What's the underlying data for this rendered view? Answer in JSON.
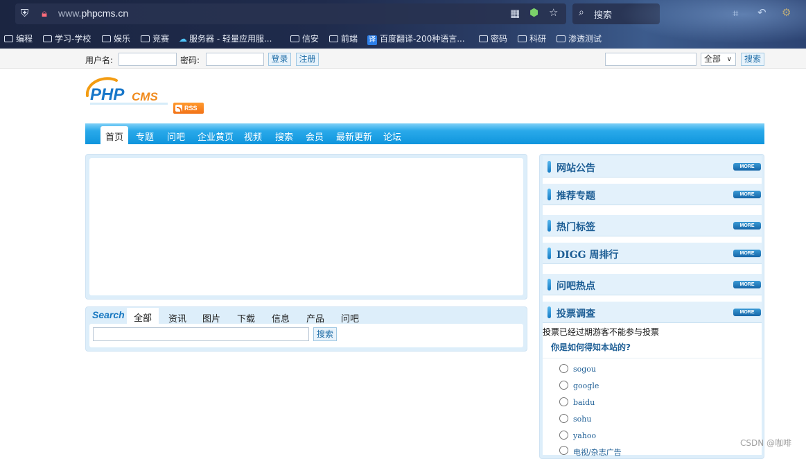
{
  "browser": {
    "url_dim": "www.",
    "url_host": "phpcms.cn",
    "search_placeholder": "搜索",
    "bookmarks": [
      {
        "label": "编程"
      },
      {
        "label": "学习-学校"
      },
      {
        "label": "娱乐"
      },
      {
        "label": "竞赛"
      },
      {
        "label": "服务器 - 轻量应用服..."
      },
      {
        "label": "信安"
      },
      {
        "label": "前端"
      },
      {
        "label": "百度翻译-200种语言..."
      },
      {
        "label": "密码"
      },
      {
        "label": "科研"
      },
      {
        "label": "渗透测试"
      }
    ],
    "translate_badge": "译"
  },
  "topbar": {
    "username_label": "用户名:",
    "password_label": "密码:",
    "login_label": "登录",
    "register_label": "注册",
    "scope_value": "全部",
    "search_label": "搜索"
  },
  "logo": {
    "text_php": "PHP",
    "text_cms": "CMS",
    "rss": "RSS"
  },
  "nav": {
    "items": [
      {
        "label": "首页"
      },
      {
        "label": "专题"
      },
      {
        "label": "问吧"
      },
      {
        "label": "企业黄页"
      },
      {
        "label": "视频"
      },
      {
        "label": "搜索"
      },
      {
        "label": "会员"
      },
      {
        "label": "最新更新"
      },
      {
        "label": "论坛"
      }
    ]
  },
  "search": {
    "title": "Search",
    "tabs": [
      {
        "label": "全部"
      },
      {
        "label": "资讯"
      },
      {
        "label": "图片"
      },
      {
        "label": "下载"
      },
      {
        "label": "信息"
      },
      {
        "label": "产品"
      },
      {
        "label": "问吧"
      }
    ],
    "button": "搜索"
  },
  "sidebar": {
    "more_label": "MORE",
    "sections": [
      {
        "title": "网站公告"
      },
      {
        "title": "推荐专题"
      },
      {
        "title": "热门标签"
      },
      {
        "title": "DIGG 周排行"
      },
      {
        "title": "问吧热点"
      },
      {
        "title": "投票调查"
      }
    ],
    "vote": {
      "note": "投票已经过期游客不能参与投票",
      "question": "你是如何得知本站的?",
      "options": [
        {
          "label": "sogou"
        },
        {
          "label": "google"
        },
        {
          "label": "baidu"
        },
        {
          "label": "sohu"
        },
        {
          "label": "yahoo"
        },
        {
          "label": "电视/杂志广告"
        }
      ]
    }
  },
  "watermark": "CSDN @咖啡"
}
